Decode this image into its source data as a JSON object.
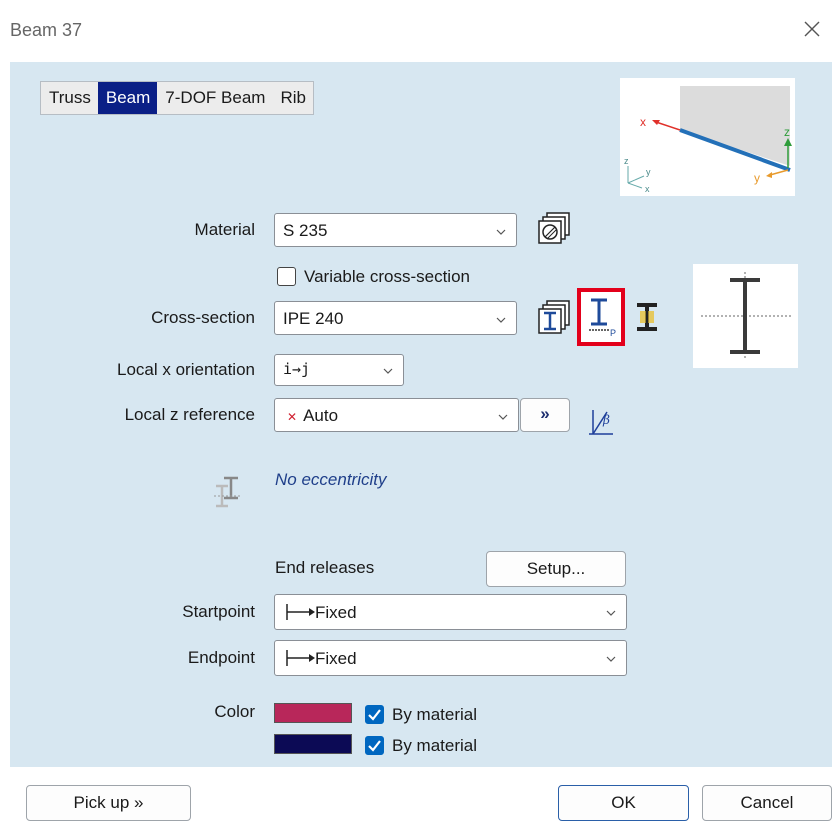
{
  "window": {
    "title": "Beam 37"
  },
  "tabs": [
    {
      "label": "Truss"
    },
    {
      "label": "Beam"
    },
    {
      "label": "7-DOF Beam"
    },
    {
      "label": "Rib"
    }
  ],
  "preview": {
    "axis_x": "x",
    "axis_z": "z",
    "axis_y": "y",
    "mini_z": "z",
    "mini_y": "y",
    "mini_x": "x"
  },
  "material": {
    "label": "Material",
    "value": "S 235"
  },
  "variable_cross_section": {
    "label": "Variable cross-section",
    "checked": false
  },
  "cross_section": {
    "label": "Cross-section",
    "value": "IPE 240"
  },
  "local_x": {
    "label": "Local x orientation",
    "value": "i→j"
  },
  "local_z": {
    "label": "Local z reference",
    "value": "Auto",
    "more_button": "»"
  },
  "eccentricity": {
    "text": "No eccentricity"
  },
  "end_releases": {
    "label": "End releases",
    "setup_button": "Setup...",
    "start_label": "Startpoint",
    "start_value": "Fixed",
    "end_label": "Endpoint",
    "end_value": "Fixed"
  },
  "color": {
    "label": "Color",
    "swatch1": "#b8275a",
    "swatch2": "#0c0a55",
    "by_material_1": "By material",
    "by_material_2": "By material",
    "checked_1": true,
    "checked_2": true
  },
  "footer": {
    "pickup_label": "Pick up »",
    "ok_label": "OK",
    "cancel_label": "Cancel"
  },
  "colors": {
    "client_bg": "#d7e7f1",
    "active_tab": "#0a1f86",
    "highlight_red": "#e3001b",
    "checkbox_blue": "#0067c0"
  }
}
